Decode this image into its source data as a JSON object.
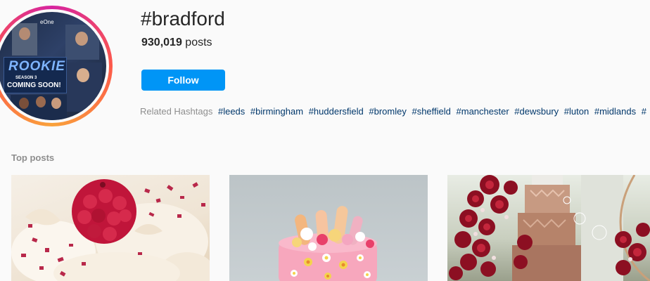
{
  "profile": {
    "avatar_text": {
      "title": "ROOKIE",
      "season": "SEASON 3",
      "coming": "COMING SOON!",
      "network": "eOne"
    }
  },
  "header": {
    "hashtag": "#bradford",
    "post_count_number": "930,019",
    "post_count_suffix": "posts",
    "follow_label": "Follow"
  },
  "related": {
    "label": "Related Hashtags",
    "tags": [
      "#leeds",
      "#birmingham",
      "#huddersfield",
      "#bromley",
      "#sheffield",
      "#manchester",
      "#dewsbury",
      "#luton",
      "#midlands",
      "#"
    ]
  },
  "top_posts": {
    "label": "Top posts"
  },
  "colors": {
    "accent": "#0095f6",
    "link": "#00376b",
    "muted": "#8e8e8e"
  }
}
